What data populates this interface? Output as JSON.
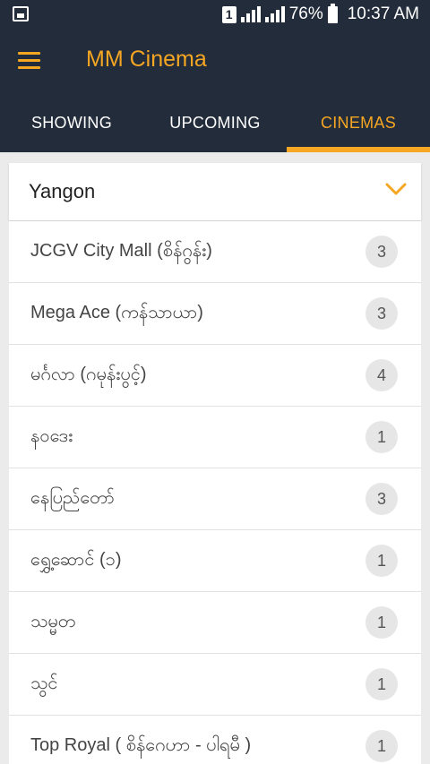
{
  "status_bar": {
    "sim_slot": "1",
    "battery": "76%",
    "time": "10:37 AM"
  },
  "app_bar": {
    "title": "MM Cinema"
  },
  "tabs": [
    {
      "label": "SHOWING"
    },
    {
      "label": "UPCOMING"
    },
    {
      "label": "CINEMAS"
    }
  ],
  "active_tab": "CINEMAS",
  "city_select": {
    "value": "Yangon"
  },
  "cinemas": [
    {
      "name": "JCGV City Mall (စိန်ဂွန်း)",
      "count": "3"
    },
    {
      "name": "Mega Ace (ကန်သာယာ)",
      "count": "3"
    },
    {
      "name": "မင်္ဂလာ (ဂမုန်းပွင့်)",
      "count": "4"
    },
    {
      "name": "နဝဒေး",
      "count": "1"
    },
    {
      "name": "နေပြည်တော်",
      "count": "3"
    },
    {
      "name": "ရွှေ့ဆောင် (၁)",
      "count": "1"
    },
    {
      "name": "သမ္မတ",
      "count": "1"
    },
    {
      "name": "သွင်",
      "count": "1"
    },
    {
      "name": "Top Royal ( စိန်ဂေဟာ - ပါရမီ )",
      "count": "1"
    }
  ],
  "colors": {
    "header_bg": "#222c3a",
    "accent": "#f5a623",
    "list_bg": "#ffffff",
    "page_bg": "#ebebeb"
  }
}
